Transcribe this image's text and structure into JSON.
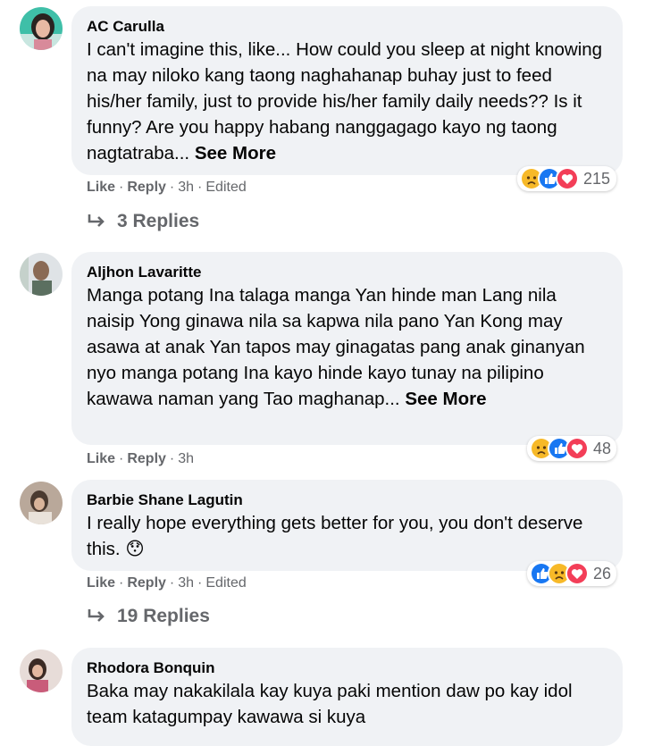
{
  "comments": [
    {
      "author": "AC Carulla",
      "text": "I can't imagine this, like... How could you sleep at night knowing na may niloko kang taong naghahanap buhay just to feed his/her family, just to provide his/her family daily needs?? Is it funny? Are you happy habang nanggagago kayo ng taong nagtatraba...",
      "see_more": "See More",
      "like": "Like",
      "reply": "Reply",
      "time": "3h",
      "edited": "Edited",
      "reaction_count": "215",
      "reactions": [
        "sad-icon",
        "like-icon",
        "love-icon"
      ],
      "replies_label": "3 Replies"
    },
    {
      "author": "Aljhon Lavaritte",
      "text": "Manga potang Ina talaga manga Yan hinde man Lang nila naisip Yong ginawa nila sa kapwa nila pano Yan Kong may asawa at anak Yan tapos may ginagatas pang anak ginanyan nyo manga potang Ina kayo hinde kayo tunay na pilipino kawawa naman yang Tao maghanap...",
      "see_more": "See More",
      "like": "Like",
      "reply": "Reply",
      "time": "3h",
      "reaction_count": "48",
      "reactions": [
        "sad-icon",
        "like-icon",
        "love-icon"
      ]
    },
    {
      "author": "Barbie Shane Lagutin",
      "text": "I really hope everything gets better for you, you don't deserve this.",
      "emoji": "😯",
      "like": "Like",
      "reply": "Reply",
      "time": "3h",
      "edited": "Edited",
      "reaction_count": "26",
      "reactions": [
        "like-icon",
        "sad-icon",
        "love-icon"
      ],
      "replies_label": "19 Replies"
    },
    {
      "author": "Rhodora Bonquin",
      "text": "Baka may nakakilala kay kuya paki mention daw po kay idol team katagumpay kawawa si kuya"
    }
  ],
  "colors": {
    "bubble": "#f0f2f5",
    "secondary_text": "#65676b",
    "like_blue": "#1877f2",
    "love_red": "#f33e58",
    "sad_yellow": "#f7b928"
  }
}
